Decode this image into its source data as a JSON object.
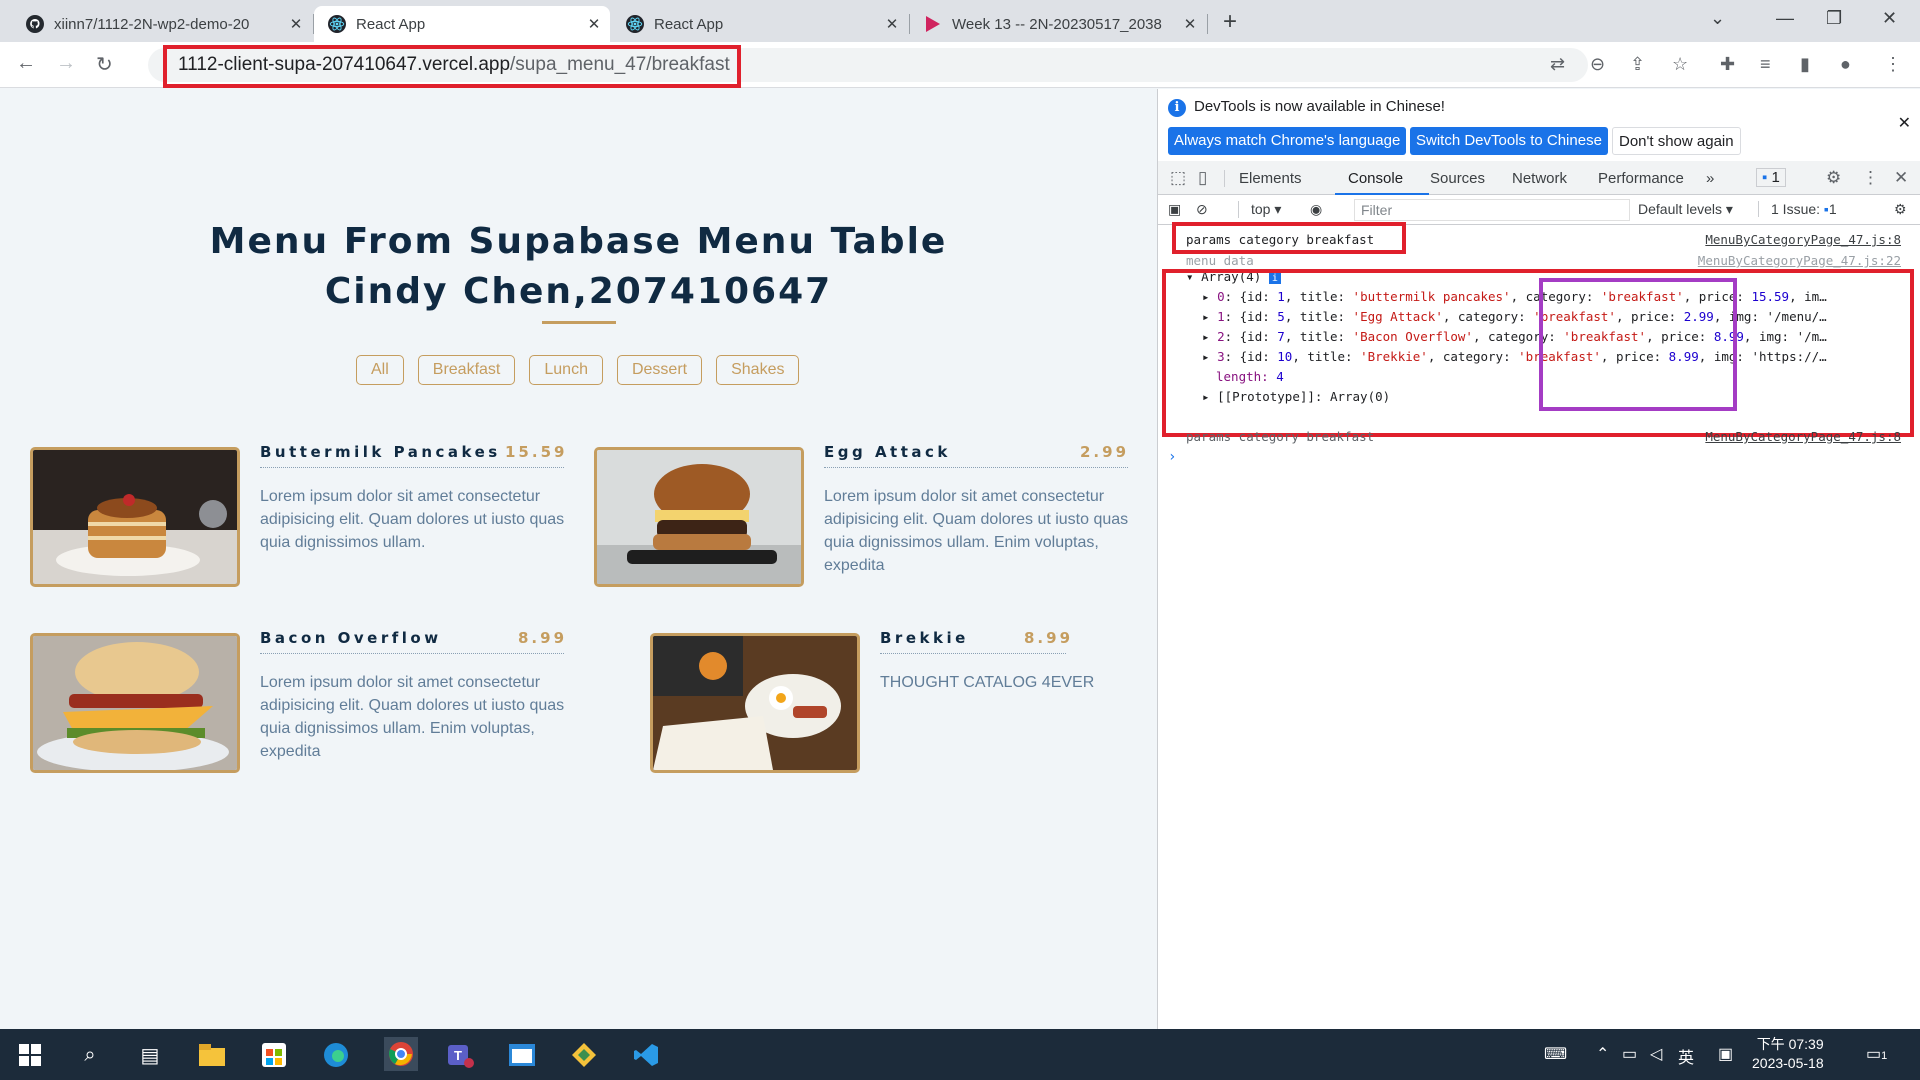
{
  "browser": {
    "tabs": [
      {
        "title": "xiinn7/1112-2N-wp2-demo-20",
        "icon": "github-icon"
      },
      {
        "title": "React App",
        "icon": "react-icon"
      },
      {
        "title": "React App",
        "icon": "react-icon"
      },
      {
        "title": "Week 13 -- 2N-20230517_2038",
        "icon": "video-icon"
      }
    ],
    "url_host": "1112-client-supa-207410647.vercel.app",
    "url_path": "/supa_menu_47/breakfast"
  },
  "page": {
    "title_line1": "Menu From Supabase Menu Table",
    "title_line2": "Cindy Chen,207410647",
    "filters": [
      "All",
      "Breakfast",
      "Lunch",
      "Dessert",
      "Shakes"
    ],
    "items": [
      {
        "name": "Buttermilk Pancakes",
        "price": "15.59",
        "desc": "Lorem ipsum dolor sit amet consectetur adipisicing elit. Quam dolores ut iusto quas quia dignissimos ullam."
      },
      {
        "name": "Egg Attack",
        "price": "2.99",
        "desc": "Lorem ipsum dolor sit amet consectetur adipisicing elit. Quam dolores ut iusto quas quia dignissimos ullam. Enim voluptas, expedita"
      },
      {
        "name": "Bacon Overflow",
        "price": "8.99",
        "desc": "Lorem ipsum dolor sit amet consectetur adipisicing elit. Quam dolores ut iusto quas quia dignissimos ullam. Enim voluptas, expedita"
      },
      {
        "name": "Brekkie",
        "price": "8.99",
        "desc": "THOUGHT CATALOG 4EVER"
      }
    ]
  },
  "devtools": {
    "banner_msg": "DevTools is now available in Chinese!",
    "banner_btn1": "Always match Chrome's language",
    "banner_btn2": "Switch DevTools to Chinese",
    "banner_btn3": "Don't show again",
    "tabs": [
      "Elements",
      "Console",
      "Sources",
      "Network",
      "Performance"
    ],
    "issues_badge": "1",
    "context": "top",
    "filter_placeholder": "Filter",
    "levels": "Default levels",
    "issue_count": "1 Issue:",
    "issue_num": "1",
    "console": {
      "line1": "params category breakfast",
      "line1_src": "MenuByCategoryPage_47.js:8",
      "line2": "menu data",
      "line2_src": "MenuByCategoryPage_47.js:22",
      "array_head": "Array(4)",
      "rows": [
        {
          "idx": "0",
          "id": "1",
          "title": "'buttermilk pancakes'",
          "category": "'breakfast'",
          "price": "15.59",
          "tail": "im…"
        },
        {
          "idx": "1",
          "id": "5",
          "title": "'Egg Attack'",
          "category": "'breakfast'",
          "price": "2.99",
          "tail": "img: '/menu/…"
        },
        {
          "idx": "2",
          "id": "7",
          "title": "'Bacon Overflow'",
          "category": "'breakfast'",
          "price": "8.99",
          "tail": "img: '/m…"
        },
        {
          "idx": "3",
          "id": "10",
          "title": "'Brekkie'",
          "category": "'breakfast'",
          "price": "8.99",
          "tail": "img: 'https://…"
        }
      ],
      "length_label": "length:",
      "length_value": "4",
      "prototype": "[[Prototype]]: Array(0)",
      "line3": "params category breakfast",
      "line3_src": "MenuByCategoryPage_47.js:8"
    }
  },
  "taskbar": {
    "clock_time": "下午 07:39",
    "clock_date": "2023-05-18",
    "ime": "英",
    "notif_count": "1"
  },
  "colors": {
    "accent": "#c59d5f",
    "heading": "#102a42",
    "highlight_red": "#e0202c",
    "highlight_purple": "#a43cc4"
  }
}
